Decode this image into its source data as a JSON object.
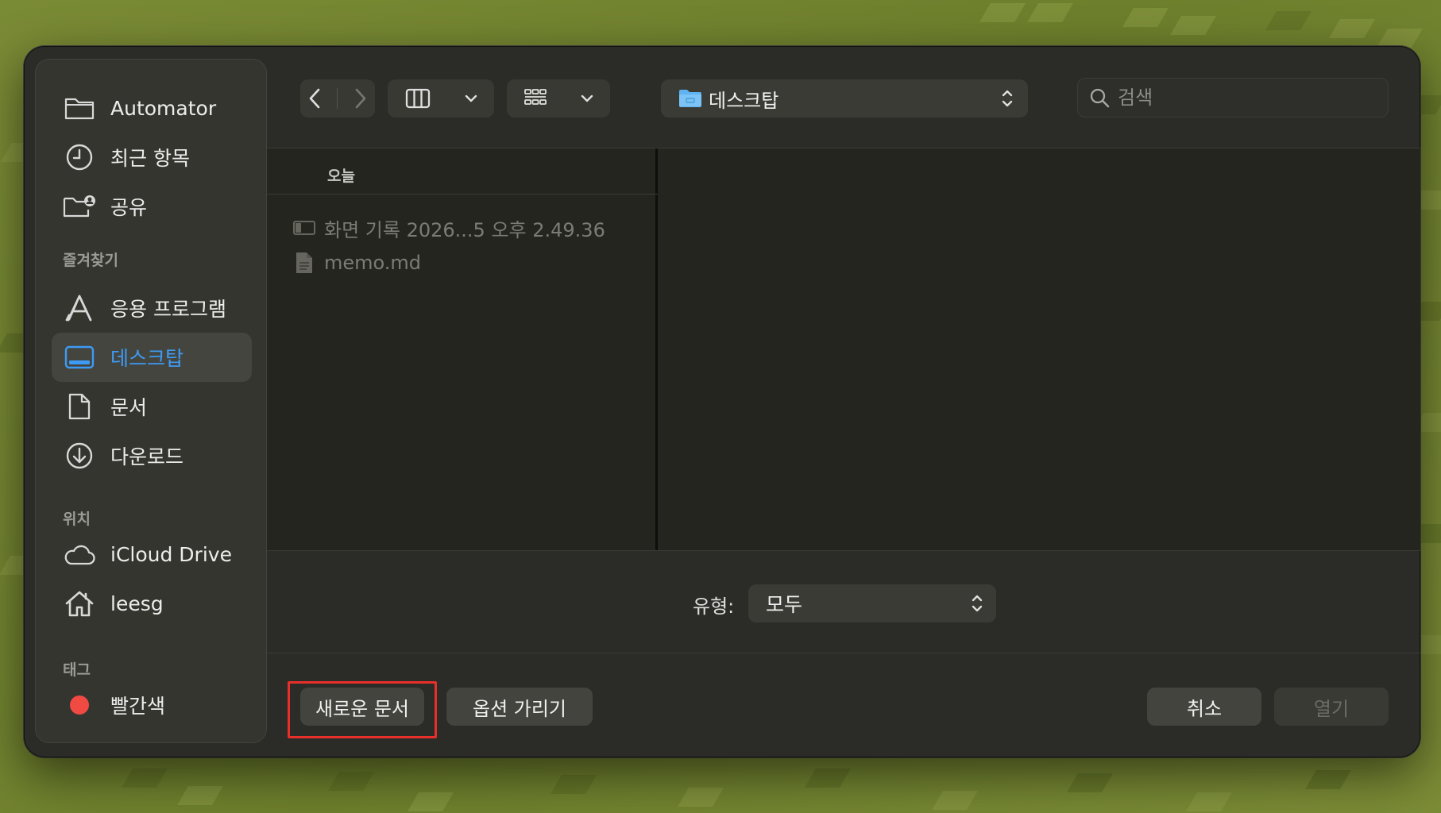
{
  "sidebar": {
    "items": [
      {
        "label": "Automator",
        "icon": "folder-icon"
      },
      {
        "label": "최근 항목",
        "icon": "clock-icon"
      },
      {
        "label": "공유",
        "icon": "shared-folder-icon"
      }
    ],
    "favorites_header": "즐겨찾기",
    "favorites": [
      {
        "label": "응용 프로그램",
        "icon": "applications-icon"
      },
      {
        "label": "데스크탑",
        "icon": "desktop-icon",
        "active": true
      },
      {
        "label": "문서",
        "icon": "document-icon"
      },
      {
        "label": "다운로드",
        "icon": "download-icon"
      }
    ],
    "locations_header": "위치",
    "locations": [
      {
        "label": "iCloud Drive",
        "icon": "cloud-icon"
      },
      {
        "label": "leesg",
        "icon": "home-icon"
      }
    ],
    "tags_header": "태그",
    "tags": [
      {
        "label": "빨간색",
        "color": "#f04a43"
      }
    ]
  },
  "toolbar": {
    "path_label": "데스크탑",
    "search_placeholder": "검색"
  },
  "browser": {
    "section_header": "오늘",
    "files": [
      {
        "name": "화면 기록 2026...5 오후 2.49.36",
        "icon": "screen-recording-file-icon"
      },
      {
        "name": "memo.md",
        "icon": "text-file-icon"
      }
    ]
  },
  "format": {
    "label": "유형:",
    "value": "모두"
  },
  "buttons": {
    "new_document": "새로운 문서",
    "hide_options": "옵션 가리기",
    "cancel": "취소",
    "open": "열기"
  },
  "colors": {
    "accent": "#3d9bf5",
    "highlight": "#e8302a",
    "dialog_bg": "#2b2b27"
  }
}
